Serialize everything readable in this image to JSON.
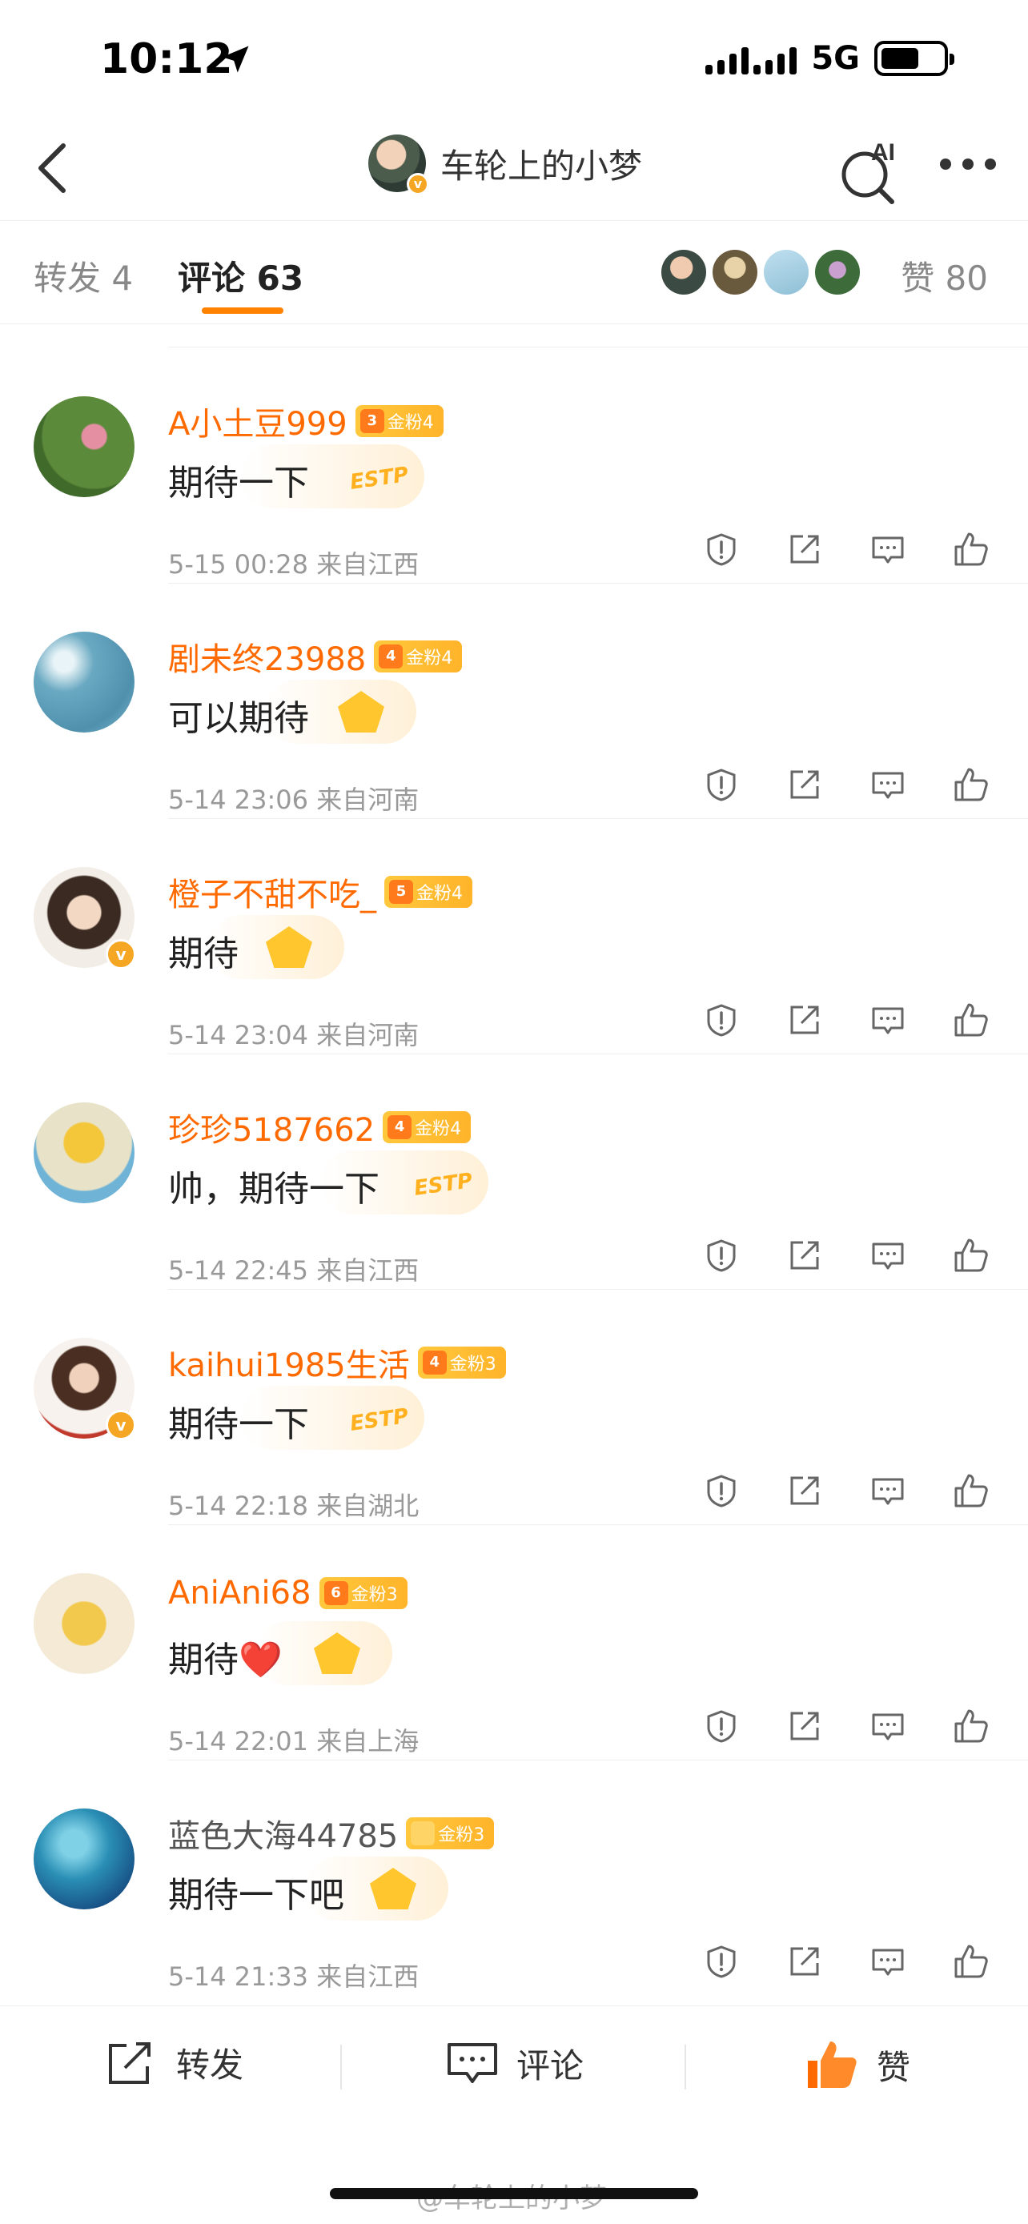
{
  "status_bar": {
    "time": "10:12",
    "network": "5G"
  },
  "nav": {
    "title": "车轮上的小梦",
    "ai_label": "AI"
  },
  "tabs": {
    "repost": "转发 4",
    "comment": "评论 63",
    "like": "赞 80"
  },
  "comments": [
    {
      "name": "A小土豆999",
      "badge_level": "3",
      "badge": "金粉4",
      "text": "期待一下",
      "decor": "ESTP",
      "meta": "5-15 00:28  来自江西",
      "verified": false,
      "name_color": "orange"
    },
    {
      "name": "剧未终23988",
      "badge_level": "4",
      "badge": "金粉4",
      "text": "可以期待",
      "decor": "",
      "meta": "5-14 23:06  来自河南",
      "verified": false,
      "name_color": "orange"
    },
    {
      "name": "橙子不甜不吃_",
      "badge_level": "5",
      "badge": "金粉4",
      "text": "期待",
      "decor": "",
      "meta": "5-14 23:04  来自河南",
      "verified": true,
      "name_color": "orange"
    },
    {
      "name": "珍珍5187662",
      "badge_level": "4",
      "badge": "金粉4",
      "text": "帅，期待一下",
      "decor": "ESTP",
      "meta": "5-14 22:45  来自江西",
      "verified": false,
      "name_color": "orange"
    },
    {
      "name": "kaihui1985生活",
      "badge_level": "4",
      "badge": "金粉3",
      "text": "期待一下",
      "decor": "ESTP",
      "meta": "5-14 22:18  来自湖北",
      "verified": true,
      "name_color": "orange"
    },
    {
      "name": "AniAni68",
      "badge_level": "6",
      "badge": "金粉3",
      "text": "期待❤️",
      "decor": "",
      "meta": "5-14 22:01  来自上海",
      "verified": false,
      "name_color": "orange"
    },
    {
      "name": "蓝色大海44785",
      "badge_level": "",
      "badge": "金粉3",
      "text": "期待一下吧",
      "decor": "",
      "meta": "5-14 21:33  来自江西",
      "verified": false,
      "name_color": "gray"
    }
  ],
  "bottom_bar": {
    "repost": "转发",
    "comment": "评论",
    "like": "赞"
  },
  "watermark": "@车轮上的小梦",
  "colors": {
    "accent": "#ff8200",
    "name_orange": "#ff6a00",
    "like_orange": "#ff6a00"
  }
}
